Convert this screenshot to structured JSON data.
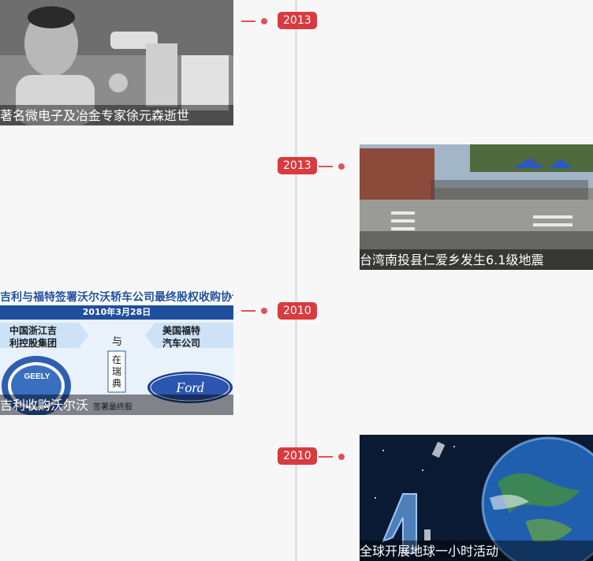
{
  "timeline": {
    "entries": [
      {
        "year": "2013",
        "title": "著名微电子及冶金专家徐元森逝世",
        "image": "portrait-photo-of-scientist-with-microscope"
      },
      {
        "year": "2013",
        "title": "台湾南投县仁爱乡发生6.1级地震",
        "image": "street-crowd-photo-after-earthquake"
      },
      {
        "year": "2010",
        "title": "吉利收购沃尔沃",
        "image": "geely-ford-agreement-infographic",
        "image_text": {
          "headline": "吉利与福特签署沃尔沃轿车公司最终股权收购协议",
          "date": "2010年3月28日",
          "left_party": [
            "中国浙江吉",
            "利控股集团"
          ],
          "and": "与",
          "place": [
            "在",
            "瑞",
            "典"
          ],
          "right_party": [
            "美国福特",
            "汽车公司"
          ],
          "partial_note": "签署最终股"
        }
      },
      {
        "year": "2010",
        "title": "全球开展地球一小时活动",
        "image": "earth-hour-earth-from-space-image"
      }
    ]
  },
  "colors": {
    "accent": "#d93a40",
    "axis": "#e1e1e1",
    "background": "#f7f7f7"
  }
}
